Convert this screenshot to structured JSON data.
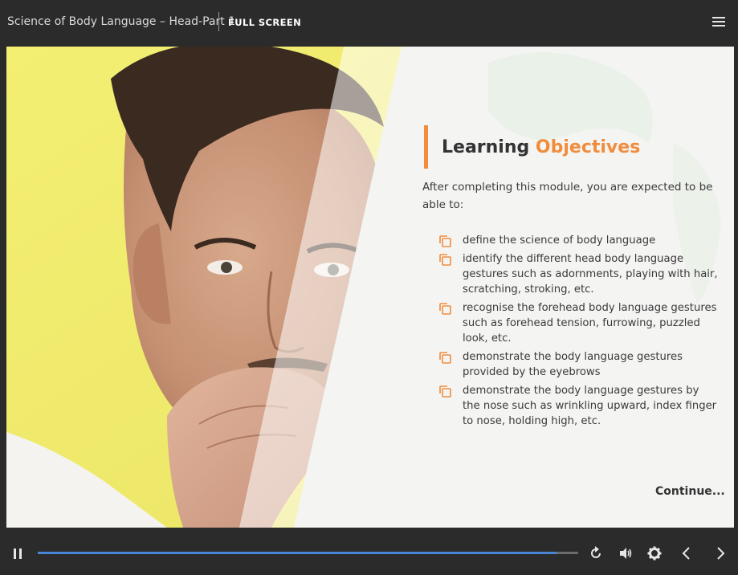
{
  "header": {
    "course_title": "Science of Body Language – Head-Part 1",
    "fullscreen_label": "FULL SCREEN",
    "menu_icon": "hamburger-menu-icon"
  },
  "slide": {
    "heading_part1": "Learning",
    "heading_part2": "Objectives",
    "intro": "After completing this module, you are expected to be able to:",
    "objectives": [
      "define the science of body language",
      "identify the different head body language gestures such as adornments, playing with hair, scratching, stroking, etc.",
      "recognise the forehead body language gestures such as forehead tension, furrowing, puzzled look, etc.",
      "demonstrate the body language gestures provided by the eyebrows",
      "demonstrate the body language gestures by the nose such as wrinkling upward, index finger to nose, holding high, etc."
    ],
    "continue_label": "Continue...",
    "accent_color": "#f08c3c"
  },
  "player": {
    "progress": 0.96,
    "progress_color": "#4a86d8",
    "icons": [
      "pause-icon",
      "replay-icon",
      "volume-icon",
      "settings-gear-icon",
      "previous-icon",
      "next-icon"
    ]
  }
}
